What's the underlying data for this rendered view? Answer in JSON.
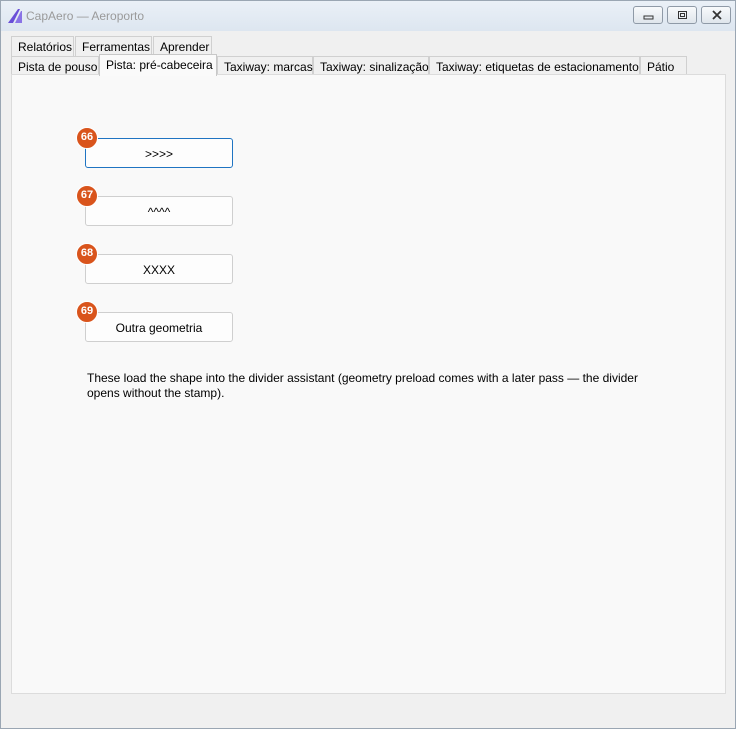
{
  "window": {
    "title": "CapAero — Aeroporto",
    "accent_color": "#6a4fd8"
  },
  "tabs_row1": [
    {
      "label": "Relatórios"
    },
    {
      "label": "Ferramentas"
    },
    {
      "label": "Aprender"
    }
  ],
  "tabs_row2": [
    {
      "label": "Pista de pouso"
    },
    {
      "label": "Pista: pré-cabeceira",
      "active": true
    },
    {
      "label": "Taxiway: marcas"
    },
    {
      "label": "Taxiway: sinalização"
    },
    {
      "label": "Taxiway: etiquetas de estacionamento"
    },
    {
      "label": "Pátio"
    }
  ],
  "buttons": [
    {
      "badge": "66",
      "label": ">>>>"
    },
    {
      "badge": "67",
      "label": "^^^^"
    },
    {
      "badge": "68",
      "label": "XXXX"
    },
    {
      "badge": "69",
      "label": "Outra geometria"
    }
  ],
  "note": "These load the shape into the divider assistant (geometry preload comes with a later pass — the divider opens without the stamp).",
  "badge_color": "#d9541c"
}
